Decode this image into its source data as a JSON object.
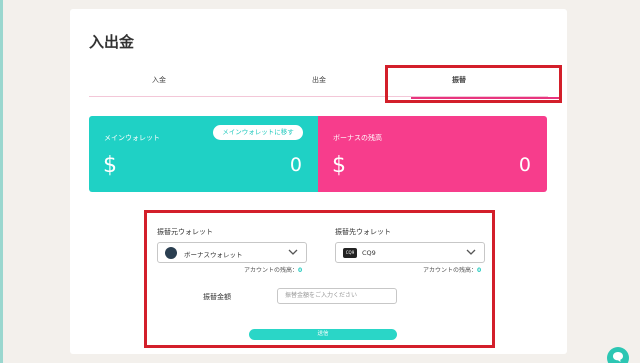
{
  "page": {
    "title": "入出金"
  },
  "tabs": [
    {
      "label": "入金"
    },
    {
      "label": "出金"
    },
    {
      "label": "振替"
    }
  ],
  "wallets": {
    "main": {
      "label": "メインウォレット",
      "currency": "$",
      "amount": "0",
      "return_button": "メインウォレットに移す"
    },
    "bonus": {
      "label": "ボーナスの残高",
      "currency": "$",
      "amount": "0"
    }
  },
  "transfer": {
    "from_label": "振替元ウォレット",
    "from_selected": "ボーナスウォレット",
    "to_label": "振替先ウォレット",
    "to_selected": "CQ9",
    "to_icon_text": "CQ9",
    "from_balance_label": "アカウントの残高：",
    "from_balance_value": "0",
    "to_balance_label": "アカウントの残高：",
    "to_balance_value": "0",
    "amount_label": "振替金額",
    "amount_placeholder": "振替金額をご入力ください",
    "submit_label": "送信"
  },
  "colors": {
    "main_wallet": "#1fd1c5",
    "bonus_wallet": "#f73d8c",
    "highlight_border": "#d31f2a",
    "tab_underline": "#e8357e"
  },
  "icons": {
    "from_wallet": "bonus-wallet-icon",
    "to_wallet": "cq9-logo-icon",
    "transfer_arrow": "double-chevron-right-icon",
    "chat": "chat-bubble-icon"
  }
}
